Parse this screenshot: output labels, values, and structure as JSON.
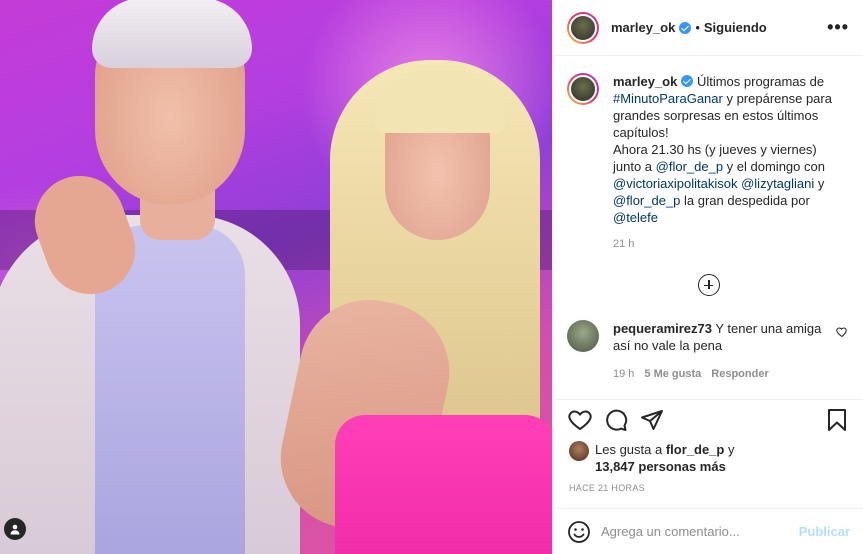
{
  "post": {
    "username": "marley_ok",
    "follow_status": "Siguiendo",
    "dot": "•",
    "more": "•••"
  },
  "caption": {
    "username": "marley_ok",
    "text_1": " Últimos programas de ",
    "hashtag": "#MinutoParaGanar",
    "text_2": " y prepárense para grandes sorpresas en estos últimos capítulos!",
    "text_3": "Ahora 21.30 hs (y jueves y viernes) junto a ",
    "mention_1": "@flor_de_p",
    "text_4": " y el domingo con ",
    "mention_2": "@victoriaxipolitakisok",
    "mention_3": "@lizytagliani",
    "text_5": " y ",
    "mention_4": "@flor_de_p",
    "text_6": " la gran despedida por ",
    "mention_5": "@telefe",
    "time": "21 h"
  },
  "comments": [
    {
      "username": "pequeramirez73",
      "text": " Y tener una amiga así no vale la pena",
      "time": "19 h",
      "likes": "5 Me gusta",
      "reply": "Responder"
    }
  ],
  "likes": {
    "prefix": "Les gusta a ",
    "user": "flor_de_p",
    "mid": " y",
    "count": "13,847 personas más"
  },
  "posted_ago": "HACE 21 HORAS",
  "add_comment": {
    "placeholder": "Agrega un comentario...",
    "publish": "Publicar"
  }
}
